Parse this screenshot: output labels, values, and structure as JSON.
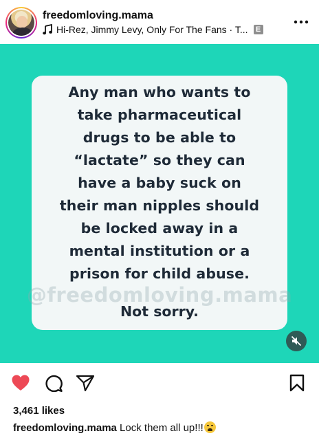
{
  "header": {
    "username": "freedomloving.mama",
    "audio": "Hi-Rez, Jimmy Levy, Only For The Fans · T...",
    "explicit_badge": "E",
    "more_icon": "more-horizontal-icon",
    "music_icon": "music-note-icon"
  },
  "post": {
    "background_color": "#1ed6b8",
    "card_color": "#f2f7f7",
    "text_color": "#1e2a37",
    "quote_lines": [
      "Any man who wants to",
      "take pharmaceutical",
      "drugs to be able to",
      "“lactate” so they can",
      "have a baby suck on",
      "their man nipples should",
      "be locked away in a",
      "mental institution or a",
      "prison for child abuse."
    ],
    "quote_end": "Not sorry.",
    "watermark": "@freedomloving.mama",
    "mute_icon": "speaker-muted-icon"
  },
  "actions": {
    "like_icon": "heart-filled-icon",
    "like_color": "#ed4956",
    "comment_icon": "comment-bubble-icon",
    "share_icon": "paper-plane-icon",
    "save_icon": "bookmark-icon"
  },
  "likes": "3,461 likes",
  "caption": {
    "username": "freedomloving.mama",
    "text": "Lock them all up!!!",
    "emoji": "weary-face-emoji"
  }
}
